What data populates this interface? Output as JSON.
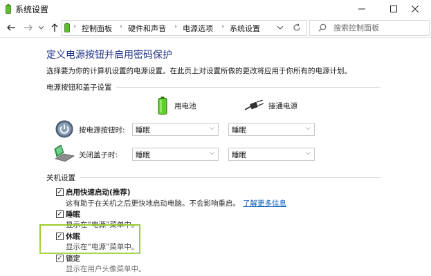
{
  "window": {
    "title": "系统设置",
    "icons": {
      "app": "battery-app-icon",
      "minimize": "minimize-icon",
      "maximize": "maximize-icon",
      "close": "close-icon"
    }
  },
  "nav": {
    "icons": [
      "back-arrow-icon",
      "forward-arrow-icon",
      "dropdown-icon",
      "up-arrow-icon",
      "refresh-icon"
    ],
    "breadcrumbs": [
      "控制面板",
      "硬件和声音",
      "电源选项",
      "系统设置"
    ],
    "search_placeholder": "搜索控制面板"
  },
  "page": {
    "title": "定义电源按钮并启用密码保护",
    "description": "选择要为你的计算机设置的电源设置。在此页上对设置所做的更改将应用于你所有的电源计划。"
  },
  "power_section": {
    "heading": "电源按钮和盖子设置",
    "battery_label": "用电池",
    "plugged_label": "接通电源",
    "rows": [
      {
        "label": "按电源按钮时:",
        "battery": "睡眠",
        "plugged": "睡眠"
      },
      {
        "label": "关闭盖子时:",
        "battery": "睡眠",
        "plugged": "睡眠"
      }
    ]
  },
  "shutdown_section": {
    "heading": "关机设置",
    "options": [
      {
        "title": "启用快速启动(推荐)",
        "desc": "这有助于在关机之后更快地启动电脑。不会影响重启。",
        "link": "了解更多信息",
        "checked": true
      },
      {
        "title": "睡眠",
        "desc": "显示在“电源”菜单中。",
        "checked": true
      },
      {
        "title": "休眠",
        "desc": "显示在“电源”菜单中。",
        "checked": true
      },
      {
        "title": "锁定",
        "desc": "显示在用户头像菜单中。",
        "checked": true
      }
    ]
  },
  "colors": {
    "title_blue": "#1e3287",
    "link_blue": "#0b5fbf",
    "highlight_green": "#9bcd2b"
  }
}
